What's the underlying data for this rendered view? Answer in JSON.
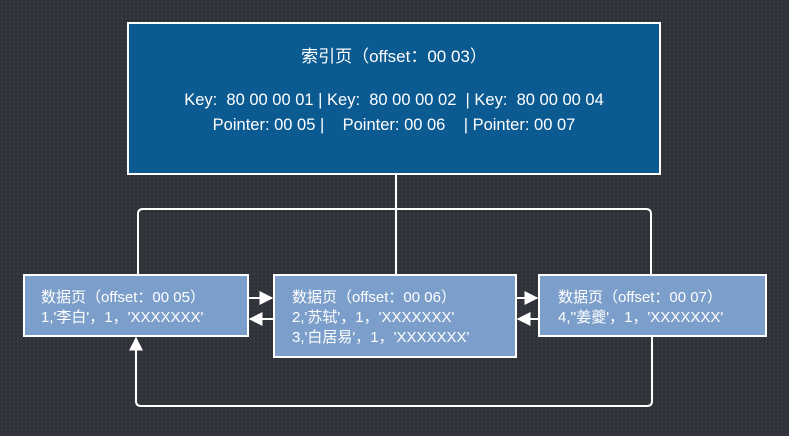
{
  "index_page": {
    "title": "索引页（offset：00 03）",
    "keys_line": "Key:  80 00 00 01 | Key:  80 00 00 02  | Key:  80 00 00 04",
    "pointers_line": "Pointer: 00 05 |    Pointer: 00 06    | Pointer: 00 07"
  },
  "data_pages": [
    {
      "title": "数据页（offset：00 05）",
      "rows": [
        "1,'李白'，1，'XXXXXXX'"
      ]
    },
    {
      "title": "数据页（offset：00 06）",
      "rows": [
        "2,'苏轼'，1，'XXXXXXX'",
        "3,'白居易'，1，'XXXXXXX'"
      ]
    },
    {
      "title": "数据页（offset：00 07）",
      "rows": [
        "4,''姜夔'，1，'XXXXXXX'"
      ]
    }
  ],
  "colors": {
    "background": "#2f3238",
    "index_fill": "#0b5a92",
    "data_fill": "#7b9fca",
    "stroke": "#ffffff"
  }
}
